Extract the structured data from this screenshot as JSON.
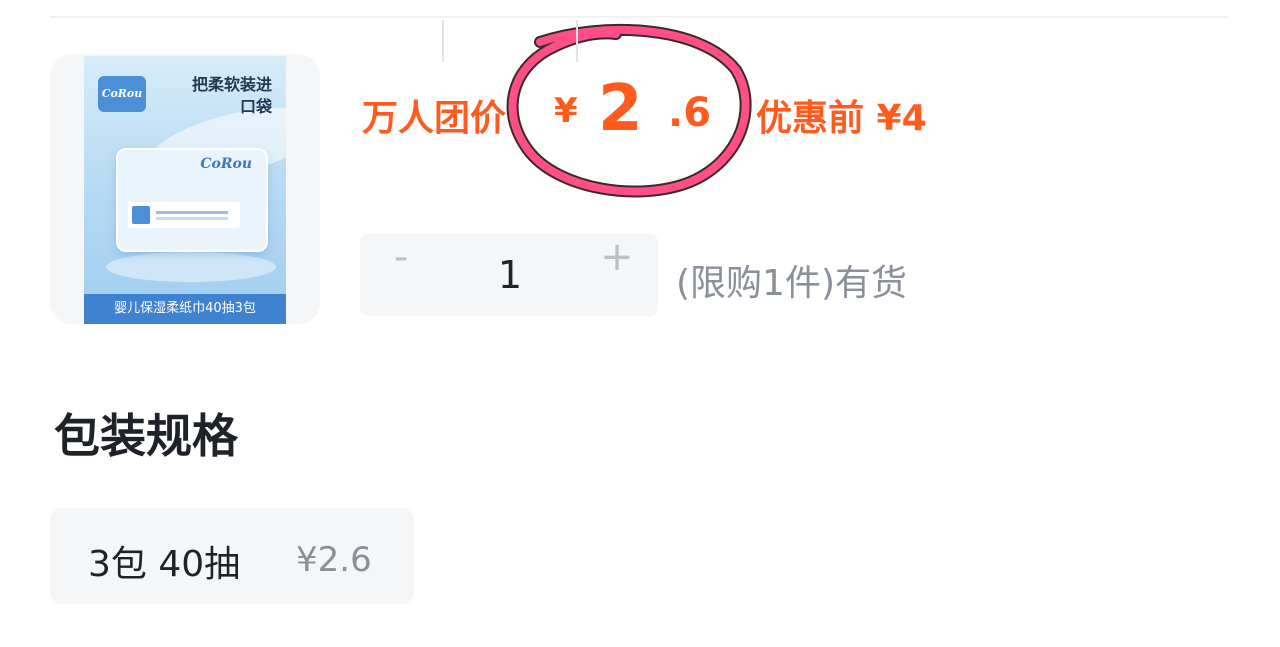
{
  "product": {
    "image": {
      "brand": "CoRou",
      "slogan": "把柔软装进口袋",
      "caption": "婴儿保湿柔纸巾40抽3包"
    },
    "price": {
      "group_label": "万人团价",
      "symbol": "¥",
      "integer": "2",
      "decimal": ".6",
      "original": "优惠前 ¥4"
    },
    "quantity": {
      "decrement": "-",
      "value": "1",
      "increment": "+",
      "note": "(限购1件)有货"
    }
  },
  "spec": {
    "title": "包装规格",
    "options": [
      {
        "label": "3包 40抽",
        "price": "¥2.6"
      }
    ]
  },
  "colors": {
    "price": "#ff5b1f",
    "highlight": "#ff4f86",
    "muted": "#8a9099",
    "chip_bg": "#f5f6f8"
  }
}
